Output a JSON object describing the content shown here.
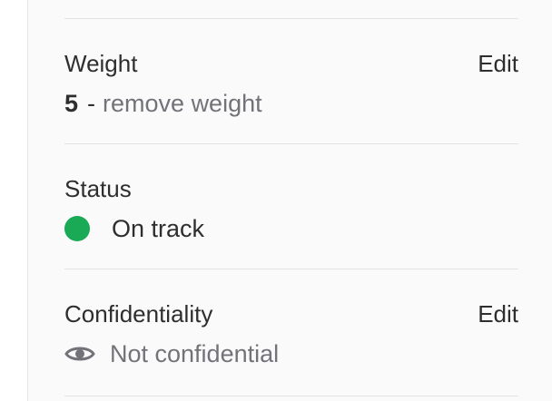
{
  "weight": {
    "title": "Weight",
    "edit_label": "Edit",
    "value": "5",
    "separator": "-",
    "remove_label": "remove weight"
  },
  "status": {
    "title": "Status",
    "value": "On track",
    "dot_color": "#1aaa55"
  },
  "confidentiality": {
    "title": "Confidentiality",
    "edit_label": "Edit",
    "value": "Not confidential",
    "icon": "eye-icon"
  }
}
